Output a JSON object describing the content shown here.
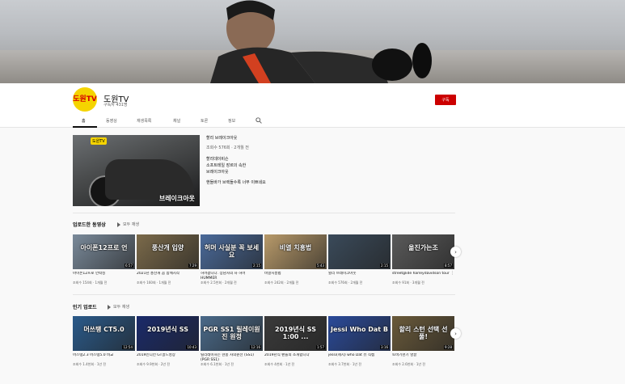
{
  "channel": {
    "name": "도원TV",
    "subscribers": "구독자 431명",
    "avatar_text": "도원TV",
    "subscribe_label": "구독"
  },
  "tabs": [
    "홈",
    "동영상",
    "재생목록",
    "채널",
    "토론",
    "정보"
  ],
  "featured": {
    "thumb_tag": "도원TV",
    "thumb_caption": "브레이크아웃",
    "title": "할리 브레이크아웃",
    "meta": "조회수 576회 · 2개월 전",
    "desc_lines": [
      "할리데이비슨",
      "소프트테일 장르의 속한",
      "브레이크아웃"
    ],
    "desc2": "핸들바가 브렉들수록 너무 이쁘네요"
  },
  "shelf1": {
    "title": "업로드한 동영상",
    "play_all": "모두 재생",
    "videos": [
      {
        "overlay": "아이폰12프로 언",
        "duration": "6:57",
        "title": "아이폰12프로 언박싱",
        "meta": "조회수 154회 · 1개월 전",
        "bg": "#7a8a9a"
      },
      {
        "overlay": "풍산개 입양",
        "duration": "7:29",
        "title": "2021년 풍산개 꼼 함께시작",
        "meta": "조회수 160회 · 1개월 전",
        "bg": "#7b6a4a"
      },
      {
        "overlay": "허머 사실분 꼭 보세요",
        "duration": "2:15",
        "title": "허머팝니다. 상남자의 차 허머 HUMMER",
        "meta": "조회수 2.5천회 · 2개월 전",
        "bg": "#4a6a9a"
      },
      {
        "overlay": "비열 치흥법",
        "duration": "5:43",
        "title": "비열치흥법",
        "meta": "조회수 242회 · 2개월 전",
        "bg": "#b89a6a"
      },
      {
        "overlay": "",
        "duration": "2:15",
        "title": "할리 브레이크아웃",
        "meta": "조회수 576회 · 2개월 전",
        "bg": "#3a4a5a"
      },
      {
        "overlay": "옮진가는조",
        "duration": "8:57",
        "title": "streetglide harleydavidson tour",
        "meta": "조회수 91회 · 3개월 전",
        "bg": "#5a5a5a"
      }
    ]
  },
  "shelf2": {
    "title": "인기 업로드",
    "play_all": "모두 재생",
    "videos": [
      {
        "overlay": "머쓰탱 CT5.0",
        "duration": "12:54",
        "title": "머스탱2.3 머스탱5.0 비교",
        "meta": "조회수 1.4천회 · 1년 전",
        "bg": "#2a5a8a"
      },
      {
        "overlay": "2019년식 SS",
        "duration": "10:43",
        "title": "2019인디언 GT골드영상",
        "meta": "조회수 9.9천회 · 2년 전",
        "bg": "#1a2a6a"
      },
      {
        "overlay": "PGR SS1 릴레이원진 원정",
        "duration": "12:16",
        "title": "릴리레이하는 현충 사의원선 (SS1)(PGR SS1)",
        "meta": "조회수 6.1천회 · 1년 전",
        "bg": "#4a6a8a"
      },
      {
        "overlay": "2019년식 SS 1:00 ...",
        "duration": "1:57",
        "title": "2019년식 팬들의 소개합니다",
        "meta": "조회수 4천회 · 1년 전",
        "bg": "#3a3a3a"
      },
      {
        "overlay": "Jessi Who Dat B",
        "duration": "3:16",
        "title": "jessi(제시) who Dat 뮤 직캠",
        "meta": "조회수 3.7천회 · 1년 전",
        "bg": "#2a4a9a"
      },
      {
        "overlay": "할리 스턴 선택 선 풀!",
        "duration": "9:28",
        "title": "토바기천기 영끌",
        "meta": "조회수 2.6천회 · 1년 전",
        "bg": "#6a5a3a"
      }
    ]
  }
}
